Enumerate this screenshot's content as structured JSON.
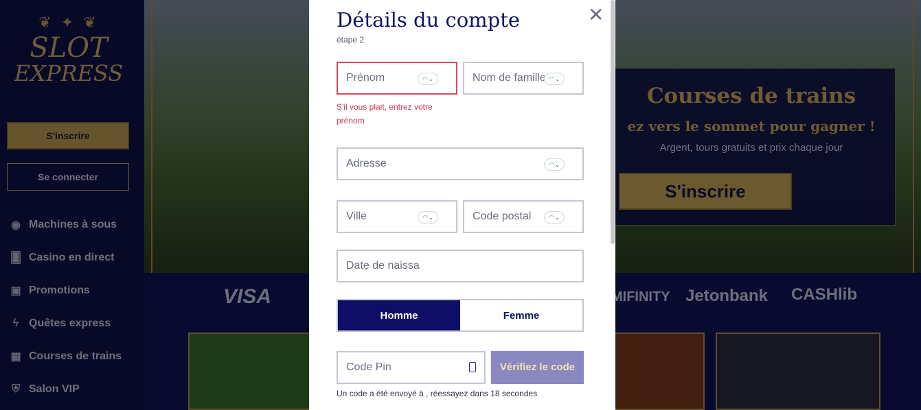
{
  "sidebar": {
    "logo_line1": "SLOT",
    "logo_line2": "EXPRESS",
    "signup_label": "S'inscrire",
    "login_label": "Se connecter",
    "items": [
      {
        "label": "Machines à sous",
        "icon": "slot-machine-icon"
      },
      {
        "label": "Casino en direct",
        "icon": "cards-icon"
      },
      {
        "label": "Promotions",
        "icon": "gift-icon"
      },
      {
        "label": "Quêtes express",
        "icon": "lightning-icon"
      },
      {
        "label": "Courses de trains",
        "icon": "train-icon"
      },
      {
        "label": "Salon VIP",
        "icon": "shield-icon"
      }
    ]
  },
  "promo": {
    "title": "Courses de trains",
    "subtitle": "ez vers le sommet pour gagner !",
    "description": "Argent, tours gratuits et prix chaque jour",
    "button_label": "S'inscrire"
  },
  "payments": [
    "VISA",
    "MIFINITY",
    "Jetonbank",
    "CASHlib"
  ],
  "modal": {
    "title": "Détails du compte",
    "step": "étape 2",
    "close_glyph": "✕",
    "fields": {
      "first_name": "Prénom",
      "last_name": "Nom de famille",
      "address": "Adresse",
      "city": "Ville",
      "postal_code": "Code postal",
      "birth_date": "Date de naissa",
      "pin_code": "Code Pin"
    },
    "first_name_error": "S'il vous plait, entrez votre prénom",
    "gender": {
      "male": "Homme",
      "female": "Femme",
      "selected": "Homme"
    },
    "verify_label": "Vérifiez le code",
    "code_note": "Un code a été envoyé à                         , réessayez dans 18 secondes"
  },
  "colors": {
    "primary_navy": "#0e0e66",
    "gold": "#c4a25a",
    "error": "#d9475e",
    "verify_button": "#8a88be"
  }
}
